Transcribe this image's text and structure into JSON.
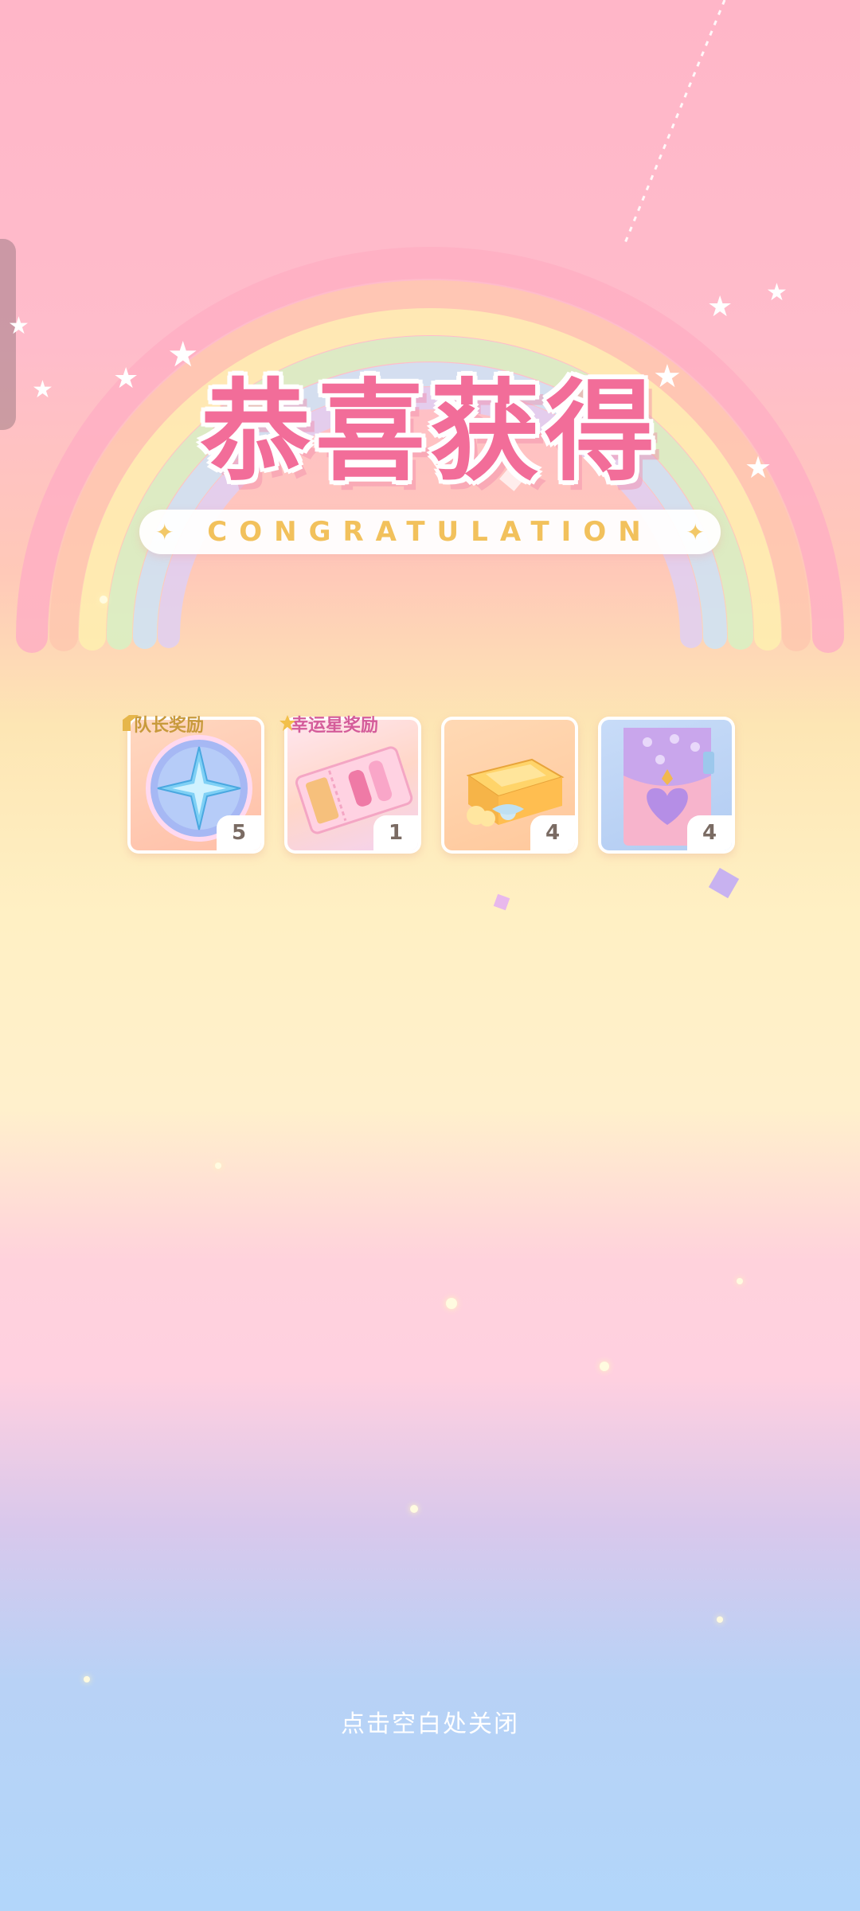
{
  "header": {
    "title": "恭喜获得",
    "subtitle": "CONGRATULATION"
  },
  "rewards": [
    {
      "badge": "队长奖励",
      "icon": "compass-medal-icon",
      "count": "5"
    },
    {
      "badge": "幸运星奖励",
      "icon": "ticket-icon",
      "count": "1"
    },
    {
      "badge": "",
      "icon": "gift-box-icon",
      "count": "4"
    },
    {
      "badge": "",
      "icon": "heart-pouch-icon",
      "count": "4"
    }
  ],
  "footer": {
    "close_hint": "点击空白处关闭"
  },
  "colors": {
    "title": "#f26d99",
    "subtitle": "#f2c15c",
    "badge_captain": "#c89a3c",
    "badge_lucky": "#d45c9a"
  }
}
